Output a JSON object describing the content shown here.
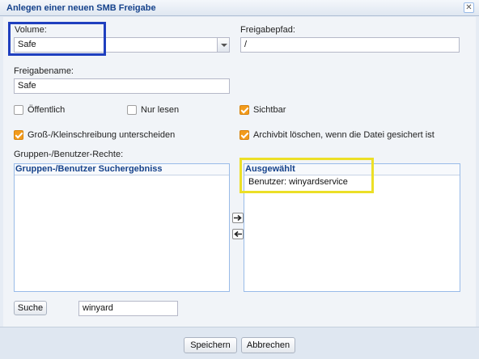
{
  "dialog": {
    "title": "Anlegen einer neuen SMB Freigabe",
    "close_icon": "close-icon"
  },
  "form": {
    "volume_label": "Volume:",
    "volume_value": "Safe",
    "path_label": "Freigabepfad:",
    "path_value": "/",
    "name_label": "Freigabename:",
    "name_value": "Safe",
    "checkboxes": [
      {
        "label": "Öffentlich",
        "checked": false
      },
      {
        "label": "Nur lesen",
        "checked": false
      },
      {
        "label": "Sichtbar",
        "checked": true
      },
      {
        "label": "Groß-/Kleinschreibung unterscheiden",
        "checked": true
      },
      {
        "label": "Archivbit löschen, wenn die Datei gesichert ist",
        "checked": true
      }
    ],
    "rights_label": "Gruppen-/Benutzer-Rechte:"
  },
  "search_panel": {
    "title": "Gruppen-/Benutzer Suchergebniss",
    "items": []
  },
  "selected_panel": {
    "title": "Ausgewählt",
    "items": [
      "Benutzer: winyardservice"
    ]
  },
  "search": {
    "button_label": "Suche",
    "query": "winyard"
  },
  "footer": {
    "save_label": "Speichern",
    "cancel_label": "Abbrechen"
  },
  "colors": {
    "accent": "#15428b",
    "checkbox_on": "#f29b1c",
    "highlight_blue": "#1f3fbf",
    "highlight_yellow": "#ecdf27"
  }
}
